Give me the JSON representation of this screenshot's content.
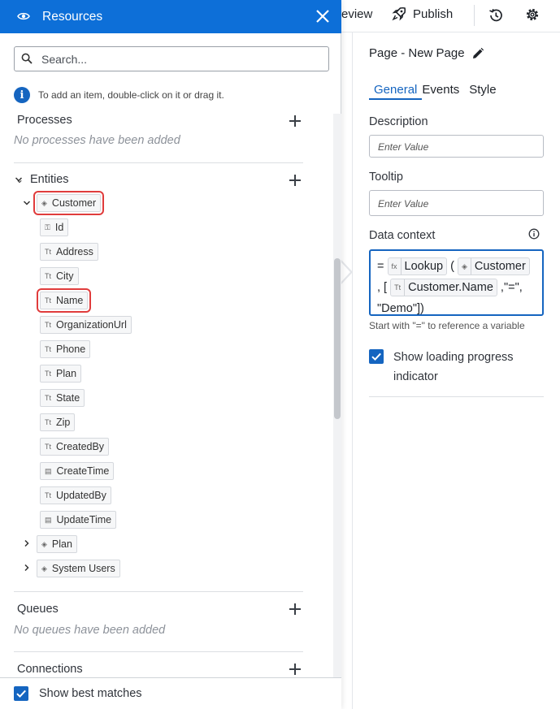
{
  "topbar": {
    "review_label": "eview",
    "publish_label": "Publish"
  },
  "properties": {
    "page_title": "Page - New Page",
    "tabs": [
      {
        "label": "General"
      },
      {
        "label": "Events"
      },
      {
        "label": "Style"
      }
    ],
    "description_label": "Description",
    "description_placeholder": "Enter Value",
    "tooltip_label": "Tooltip",
    "tooltip_placeholder": "Enter Value",
    "data_context_label": "Data context",
    "expression": {
      "equals": "=",
      "lookup": "Lookup",
      "open_paren": "(",
      "customer": "Customer",
      "comma_bracket": ", [",
      "customer_name": "Customer.Name",
      "operator": ",\"=\",",
      "value": "\"Demo\"])"
    },
    "hint": "Start with \"=\" to reference a variable",
    "show_loading_label": "Show loading progress indicator"
  },
  "resources": {
    "title": "Resources",
    "search_placeholder": "Search...",
    "info_text": "To add an item, double-click on it or drag it.",
    "processes": {
      "title": "Processes",
      "empty": "No processes have been added"
    },
    "entities": {
      "title": "Entities",
      "customer": "Customer",
      "fields": [
        {
          "label": "Id",
          "icon": "key-icon"
        },
        {
          "label": "Address",
          "icon": "text-field-icon"
        },
        {
          "label": "City",
          "icon": "text-field-icon"
        },
        {
          "label": "Name",
          "icon": "text-field-icon"
        },
        {
          "label": "OrganizationUrl",
          "icon": "text-field-icon"
        },
        {
          "label": "Phone",
          "icon": "text-field-icon"
        },
        {
          "label": "Plan",
          "icon": "text-field-icon"
        },
        {
          "label": "State",
          "icon": "text-field-icon"
        },
        {
          "label": "Zip",
          "icon": "text-field-icon"
        },
        {
          "label": "CreatedBy",
          "icon": "text-field-icon"
        },
        {
          "label": "CreateTime",
          "icon": "date-field-icon"
        },
        {
          "label": "UpdatedBy",
          "icon": "text-field-icon"
        },
        {
          "label": "UpdateTime",
          "icon": "date-field-icon"
        }
      ],
      "plan": "Plan",
      "system_users": "System Users"
    },
    "queues": {
      "title": "Queues",
      "empty": "No queues have been added"
    },
    "connections": {
      "title": "Connections"
    },
    "show_best_matches": "Show best matches"
  },
  "colors": {
    "accent": "#0d6fd8",
    "highlight": "#e03c3c",
    "focus": "#1565c0"
  }
}
